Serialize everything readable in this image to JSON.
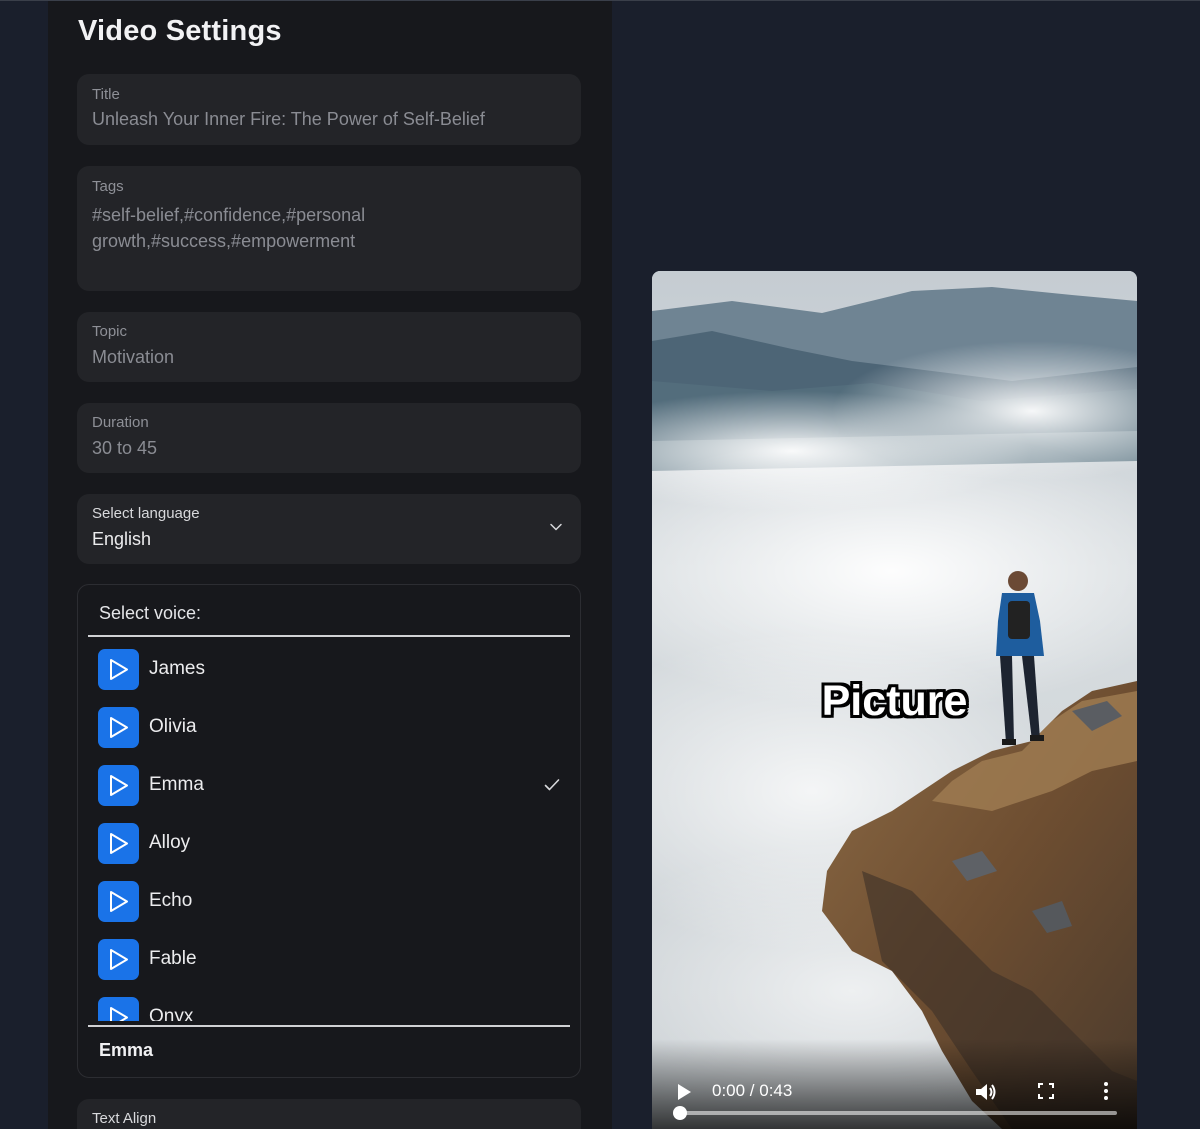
{
  "page": {
    "title": "Video Settings"
  },
  "fields": {
    "title": {
      "label": "Title",
      "value": "Unleash Your Inner Fire: The Power of Self-Belief"
    },
    "tags": {
      "label": "Tags",
      "value_line1": "#self-belief,#confidence,#personal",
      "value_line2": "growth,#success,#empowerment"
    },
    "topic": {
      "label": "Topic",
      "value": "Motivation"
    },
    "duration": {
      "label": "Duration",
      "value": "30 to 45"
    },
    "language": {
      "label": "Select language",
      "value": "English"
    },
    "text_align": {
      "label": "Text Align"
    }
  },
  "voice": {
    "heading": "Select voice:",
    "items": [
      {
        "name": "James",
        "selected": false
      },
      {
        "name": "Olivia",
        "selected": false
      },
      {
        "name": "Emma",
        "selected": true
      },
      {
        "name": "Alloy",
        "selected": false
      },
      {
        "name": "Echo",
        "selected": false
      },
      {
        "name": "Fable",
        "selected": false
      },
      {
        "name": "Onyx",
        "selected": false
      }
    ],
    "selected": "Emma"
  },
  "preview": {
    "overlay_text": "Picture",
    "time": "0:00 / 0:43",
    "progress_fraction": 0.0
  },
  "colors": {
    "accent": "#1a73e8",
    "panel": "#17181c",
    "field": "#232428",
    "page": "#1a1f2c"
  },
  "icons": {
    "play": "play-icon",
    "check": "check-icon",
    "chevron": "chevron-down-icon",
    "volume": "volume-icon",
    "fullscreen": "fullscreen-icon",
    "more": "more-vertical-icon"
  }
}
